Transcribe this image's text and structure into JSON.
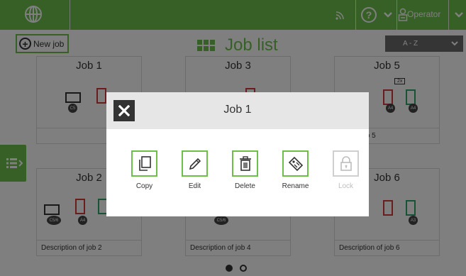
{
  "topbar": {
    "operator_label": "Operator"
  },
  "page": {
    "new_job_label": "New job",
    "title": "Job list",
    "sort_value": "A - Z"
  },
  "cards": [
    {
      "title": "Job 1",
      "description": ""
    },
    {
      "title": "Job 3",
      "description": ""
    },
    {
      "title": "Job 5",
      "description": "ion of Job 5"
    },
    {
      "title": "Job 2",
      "description": "Description of job 2"
    },
    {
      "title": "",
      "description": "Description of job 4"
    },
    {
      "title": "Job 6",
      "description": "Description of job 6"
    }
  ],
  "badges": {
    "c5": "C5",
    "c56": "C5/6",
    "a4": "A4",
    "a3": "A3",
    "two_x": "2x"
  },
  "dialog": {
    "title": "Job 1",
    "actions": [
      {
        "label": "Copy"
      },
      {
        "label": "Edit"
      },
      {
        "label": "Delete"
      },
      {
        "label": "Rename"
      },
      {
        "label": "Lock"
      }
    ]
  },
  "pager": {
    "pages": 2,
    "current": 1
  },
  "colors": {
    "accent": "#6cc04a",
    "dark": "#333333",
    "overlay": "rgba(0,0,0,0.5)"
  }
}
